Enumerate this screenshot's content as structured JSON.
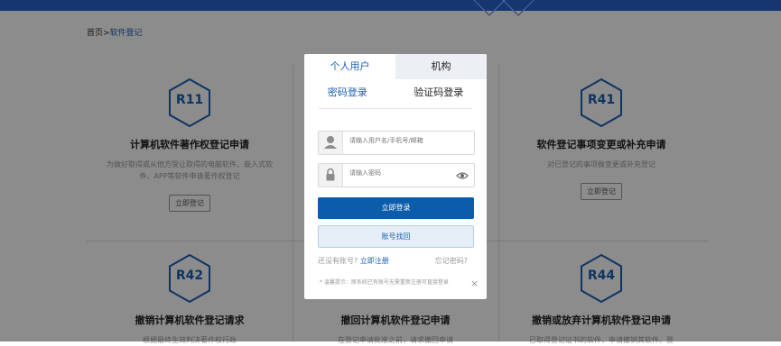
{
  "breadcrumb": {
    "home": "首页>",
    "current": "软件登记"
  },
  "cards": [
    {
      "code": "R11",
      "title": "计算机软件著作权登记申请",
      "desc": "为做好取得或从他方受让取得的电脑软件、嵌入式软件、APP等软件申请著作权登记",
      "button": "立即登记"
    },
    {
      "code": "R41",
      "title": "软件登记事项变更或补充申请",
      "desc": "对已登记的事项做变更或补充登记",
      "button": "立即登记"
    },
    {
      "code": "R42",
      "title": "撤销计算机软件登记请求",
      "desc": "根据最终生效判决著作权行政"
    },
    {
      "code": "R44",
      "title": "撤销或放弃计算机软件登记申请",
      "desc": "已取得登记证书的软件，申请撤销其软件、登"
    },
    {
      "title": "撤回计算机软件登记申请",
      "desc": "在登记申请批准之前，请求撤回申请"
    }
  ],
  "login": {
    "tabs": [
      "个人用户",
      "机构"
    ],
    "modes": [
      "密码登录",
      "验证码登录"
    ],
    "username_placeholder": "请输入用户名/手机号/邮箱",
    "password_placeholder": "请输入密码",
    "login_button": "立即登录",
    "recover_button": "账号找回",
    "no_account": "还没有账号?",
    "register": "立即注册",
    "forgot": "忘记密码?",
    "notice": "* 温馨提示：原系统已有账号无需重新注册可直接登录",
    "close": "×"
  }
}
